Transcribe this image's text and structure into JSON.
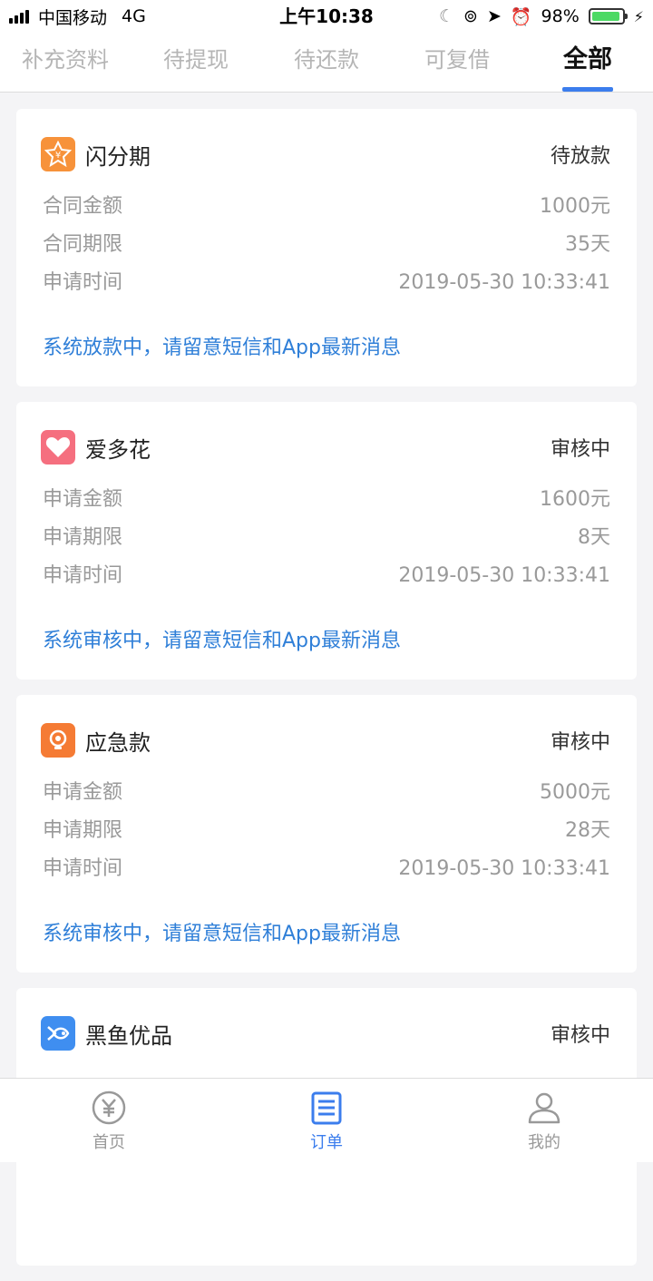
{
  "status_bar": {
    "carrier": "中国移动",
    "network": "4G",
    "time": "上午10:38",
    "battery": "98%"
  },
  "tabs": [
    {
      "label": "补充资料",
      "active": false
    },
    {
      "label": "待提现",
      "active": false
    },
    {
      "label": "待还款",
      "active": false
    },
    {
      "label": "可复借",
      "active": false
    },
    {
      "label": "全部",
      "active": true
    }
  ],
  "orders": [
    {
      "name": "闪分期",
      "status": "待放款",
      "logo_color": "#f7923a",
      "logo_icon": "yen-star-icon",
      "rows": [
        {
          "label": "合同金额",
          "value": "1000元"
        },
        {
          "label": "合同期限",
          "value": "35天"
        },
        {
          "label": "申请时间",
          "value": "2019-05-30 10:33:41"
        }
      ],
      "message": "系统放款中，请留意短信和App最新消息"
    },
    {
      "name": "爱多花",
      "status": "审核中",
      "logo_color": "#f56f7f",
      "logo_icon": "heart-icon",
      "rows": [
        {
          "label": "申请金额",
          "value": "1600元"
        },
        {
          "label": "申请期限",
          "value": "8天"
        },
        {
          "label": "申请时间",
          "value": "2019-05-30 10:33:41"
        }
      ],
      "message": "系统审核中，请留意短信和App最新消息"
    },
    {
      "name": "应急款",
      "status": "审核中",
      "logo_color": "#f57b34",
      "logo_icon": "bulb-icon",
      "rows": [
        {
          "label": "申请金额",
          "value": "5000元"
        },
        {
          "label": "申请期限",
          "value": "28天"
        },
        {
          "label": "申请时间",
          "value": "2019-05-30 10:33:41"
        }
      ],
      "message": "系统审核中，请留意短信和App最新消息"
    },
    {
      "name": "黑鱼优品",
      "status": "审核中",
      "logo_color": "#3f8ef0",
      "logo_icon": "fish-icon"
    }
  ],
  "bottom_nav": [
    {
      "label": "首页",
      "icon": "yen-circle-icon",
      "active": false
    },
    {
      "label": "订单",
      "icon": "clipboard-icon",
      "active": true
    },
    {
      "label": "我的",
      "icon": "user-icon",
      "active": false
    }
  ],
  "colors": {
    "accent": "#3b7ded",
    "link": "#2f7fd8"
  }
}
